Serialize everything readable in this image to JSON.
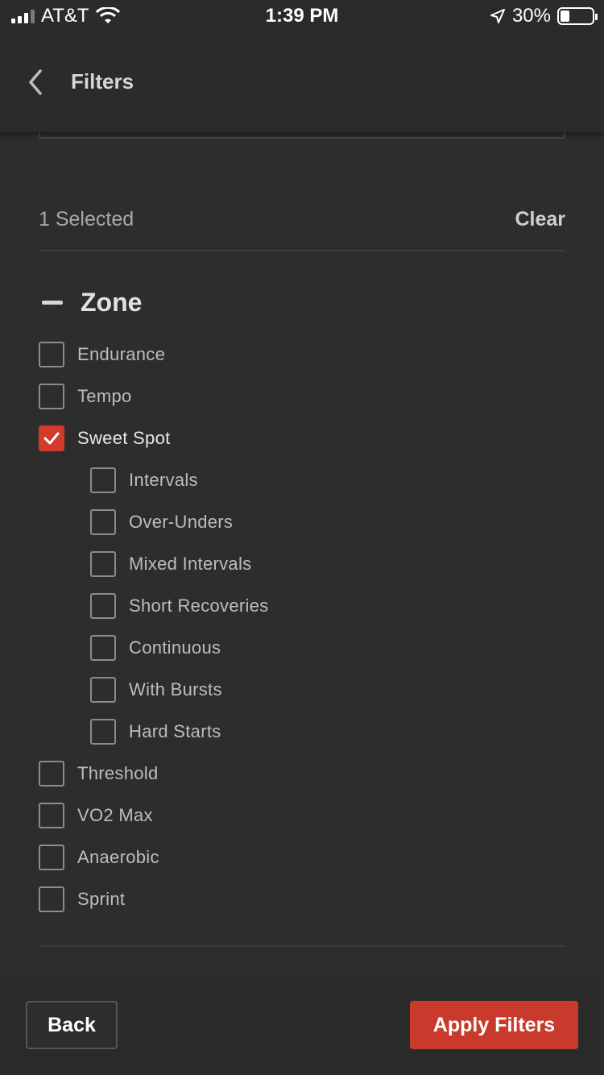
{
  "status_bar": {
    "carrier": "AT&T",
    "time": "1:39 PM",
    "battery_percent": "30%",
    "battery_level": 0.3
  },
  "nav": {
    "title": "Filters",
    "back_icon": "chevron-left-icon"
  },
  "selection": {
    "count_label": "1 Selected",
    "clear_label": "Clear"
  },
  "zone": {
    "title": "Zone",
    "toggle_icon": "minus-icon",
    "options": [
      {
        "label": "Endurance",
        "checked": false
      },
      {
        "label": "Tempo",
        "checked": false
      },
      {
        "label": "Sweet Spot",
        "checked": true
      },
      {
        "label": "Threshold",
        "checked": false
      },
      {
        "label": "VO2 Max",
        "checked": false
      },
      {
        "label": "Anaerobic",
        "checked": false
      },
      {
        "label": "Sprint",
        "checked": false
      }
    ],
    "sub_options": [
      {
        "label": "Intervals",
        "checked": false
      },
      {
        "label": "Over-Unders",
        "checked": false
      },
      {
        "label": "Mixed Intervals",
        "checked": false
      },
      {
        "label": "Short Recoveries",
        "checked": false
      },
      {
        "label": "Continuous",
        "checked": false
      },
      {
        "label": "With Bursts",
        "checked": false
      },
      {
        "label": "Hard Starts",
        "checked": false
      }
    ]
  },
  "footer": {
    "back_label": "Back",
    "apply_label": "Apply Filters"
  },
  "colors": {
    "accent": "#c93a2c",
    "background": "#2d2d2d"
  }
}
